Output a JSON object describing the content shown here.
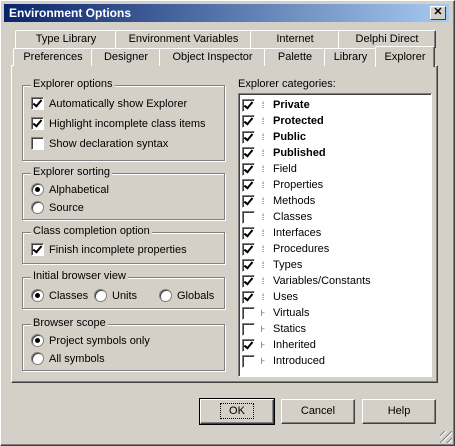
{
  "window": {
    "title": "Environment Options",
    "close_glyph": "✕"
  },
  "tabs_back": [
    "Type Library",
    "Environment Variables",
    "Internet",
    "Delphi Direct"
  ],
  "tabs_front": [
    "Preferences",
    "Designer",
    "Object Inspector",
    "Palette",
    "Library",
    "Explorer"
  ],
  "active_tab": "Explorer",
  "explorer_options": {
    "legend": "Explorer options",
    "items": [
      {
        "label": "Automatically show Explorer",
        "checked": true
      },
      {
        "label": "Highlight incomplete class items",
        "checked": true
      },
      {
        "label": "Show declaration syntax",
        "checked": false
      }
    ]
  },
  "explorer_sorting": {
    "legend": "Explorer sorting",
    "items": [
      {
        "label": "Alphabetical",
        "selected": true
      },
      {
        "label": "Source",
        "selected": false
      }
    ]
  },
  "class_completion": {
    "legend": "Class completion option",
    "items": [
      {
        "label": "Finish incomplete properties",
        "checked": true
      }
    ]
  },
  "browser_view": {
    "legend": "Initial browser view",
    "items": [
      {
        "label": "Classes",
        "selected": true
      },
      {
        "label": "Units",
        "selected": false
      },
      {
        "label": "Globals",
        "selected": false
      }
    ]
  },
  "browser_scope": {
    "legend": "Browser scope",
    "items": [
      {
        "label": "Project symbols only",
        "selected": true
      },
      {
        "label": "All symbols",
        "selected": false
      }
    ]
  },
  "categories": {
    "label": "Explorer categories:",
    "items": [
      {
        "label": "Private",
        "checked": true,
        "bold": true
      },
      {
        "label": "Protected",
        "checked": true,
        "bold": true
      },
      {
        "label": "Public",
        "checked": true,
        "bold": true
      },
      {
        "label": "Published",
        "checked": true,
        "bold": true
      },
      {
        "label": "Field",
        "checked": true,
        "bold": false
      },
      {
        "label": "Properties",
        "checked": true,
        "bold": false
      },
      {
        "label": "Methods",
        "checked": true,
        "bold": false
      },
      {
        "label": "Classes",
        "checked": false,
        "bold": false
      },
      {
        "label": "Interfaces",
        "checked": true,
        "bold": false
      },
      {
        "label": "Procedures",
        "checked": true,
        "bold": false
      },
      {
        "label": "Types",
        "checked": true,
        "bold": false
      },
      {
        "label": "Variables/Constants",
        "checked": true,
        "bold": false
      },
      {
        "label": "Uses",
        "checked": true,
        "bold": false
      },
      {
        "label": "Virtuals",
        "checked": false,
        "bold": false
      },
      {
        "label": "Statics",
        "checked": false,
        "bold": false
      },
      {
        "label": "Inherited",
        "checked": true,
        "bold": false
      },
      {
        "label": "Introduced",
        "checked": false,
        "bold": false
      }
    ]
  },
  "buttons": {
    "ok": "OK",
    "cancel": "Cancel",
    "help": "Help"
  }
}
